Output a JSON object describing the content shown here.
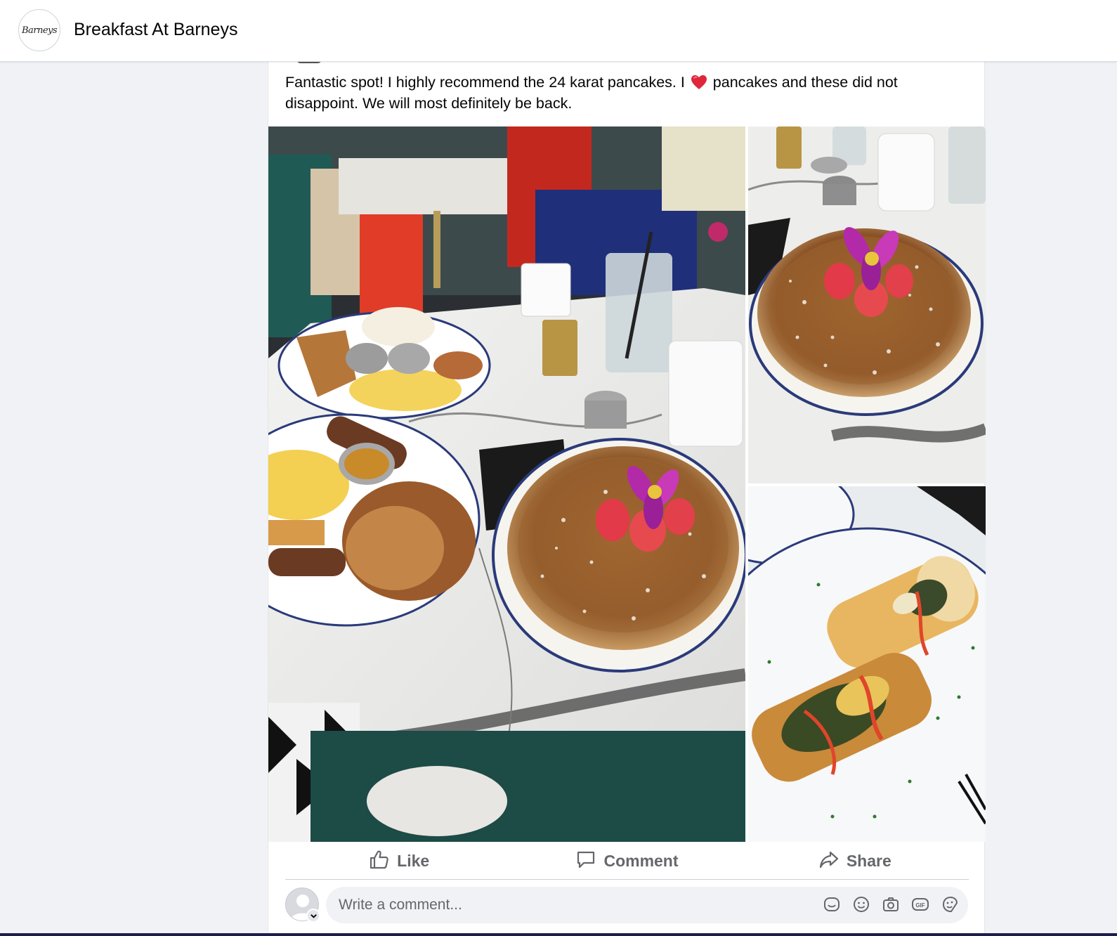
{
  "header": {
    "page_name": "Breakfast At Barneys",
    "avatar_logo_text": "Barneys"
  },
  "post": {
    "text_before_emoji": "Fantastic spot! I highly recommend the 24 karat pancakes. I ",
    "emoji": "heart-icon",
    "text_after_emoji": " pancakes and these did not disappoint. We will most definitely be back.",
    "photos": [
      {
        "name": "breakfast-table-photo"
      },
      {
        "name": "pancakes-photo"
      },
      {
        "name": "egg-rolls-photo"
      }
    ]
  },
  "actions": {
    "like_label": "Like",
    "comment_label": "Comment",
    "share_label": "Share"
  },
  "comment_box": {
    "placeholder": "Write a comment...",
    "tools": [
      "sticker-icon",
      "emoji-icon",
      "camera-icon",
      "gif-icon",
      "avatar-sticker-icon"
    ]
  },
  "colors": {
    "accent_text": "#65676b",
    "background": "#f0f2f5",
    "card": "#ffffff"
  }
}
